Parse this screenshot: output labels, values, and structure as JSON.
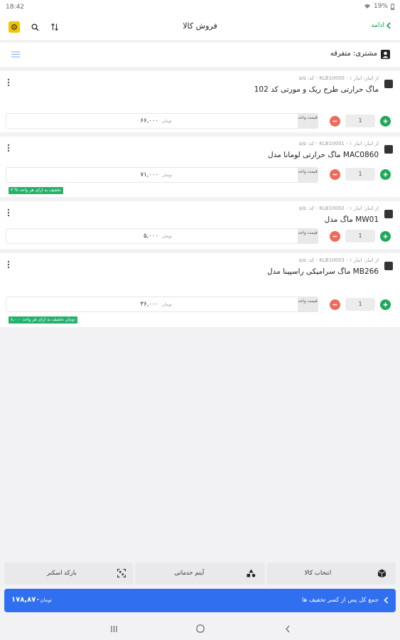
{
  "status_bar": {
    "time": "18:42",
    "battery": "19%"
  },
  "header": {
    "title": "فروش کالا",
    "continue_label": "ادامه"
  },
  "customer": {
    "label": "مشتری: متفرقه"
  },
  "items": [
    {
      "meta": "کد: ۵/۵ - KLB10000 - از انبار: انبار ۱",
      "name": "ماگ حرارتی طرح ریک و مورتی کد 102",
      "unit_label": "قیمت واحد",
      "price": "۶۶,۰۰۰",
      "currency": "تومان",
      "quantity": "1",
      "discount": ""
    },
    {
      "meta": "کد: ۵/۵ - KLB10001 - از انبار: انبار ۱",
      "name": "ماگ حرارتی لومانا مدل MAC0860",
      "unit_label": "قیمت واحد",
      "price": "۷۱,۰۰۰",
      "currency": "تومان",
      "quantity": "1",
      "discount": "۳ % تخفیف به ازای هر واحد"
    },
    {
      "meta": "کد: ۵/۵ - KLB10002 - از انبار: انبار ۱",
      "name": "ماگ مدل MW01",
      "unit_label": "قیمت واحد",
      "price": "۵,۰۰۰",
      "currency": "تومان",
      "quantity": "1",
      "discount": ""
    },
    {
      "meta": "کد: ۵/۵ - KLB10003 - از انبار: انبار ۱",
      "name": "ماگ سرامیکی راسپینا مدل MB266",
      "unit_label": "قیمت واحد",
      "price": "۳۶,۰۰۰",
      "currency": "تومان",
      "quantity": "1",
      "discount": "۸,۰۰۰ تومان تخفیف به ازای هر واحد"
    }
  ],
  "actions": {
    "select_product": "انتخاب کالا",
    "service_item": "آیتم خدماتی",
    "barcode_scanner": "بارکد اسکنر"
  },
  "total": {
    "label": "جمع کل پس از کسر تخفیف ها",
    "value": "۱۷۸,۸۷۰",
    "currency": "تومان"
  },
  "colors": {
    "accent": "#2f6ff0",
    "plus": "#1ea85a",
    "minus": "#ef6a5b",
    "brand": "#f2c200",
    "discount": "#23b26d"
  }
}
